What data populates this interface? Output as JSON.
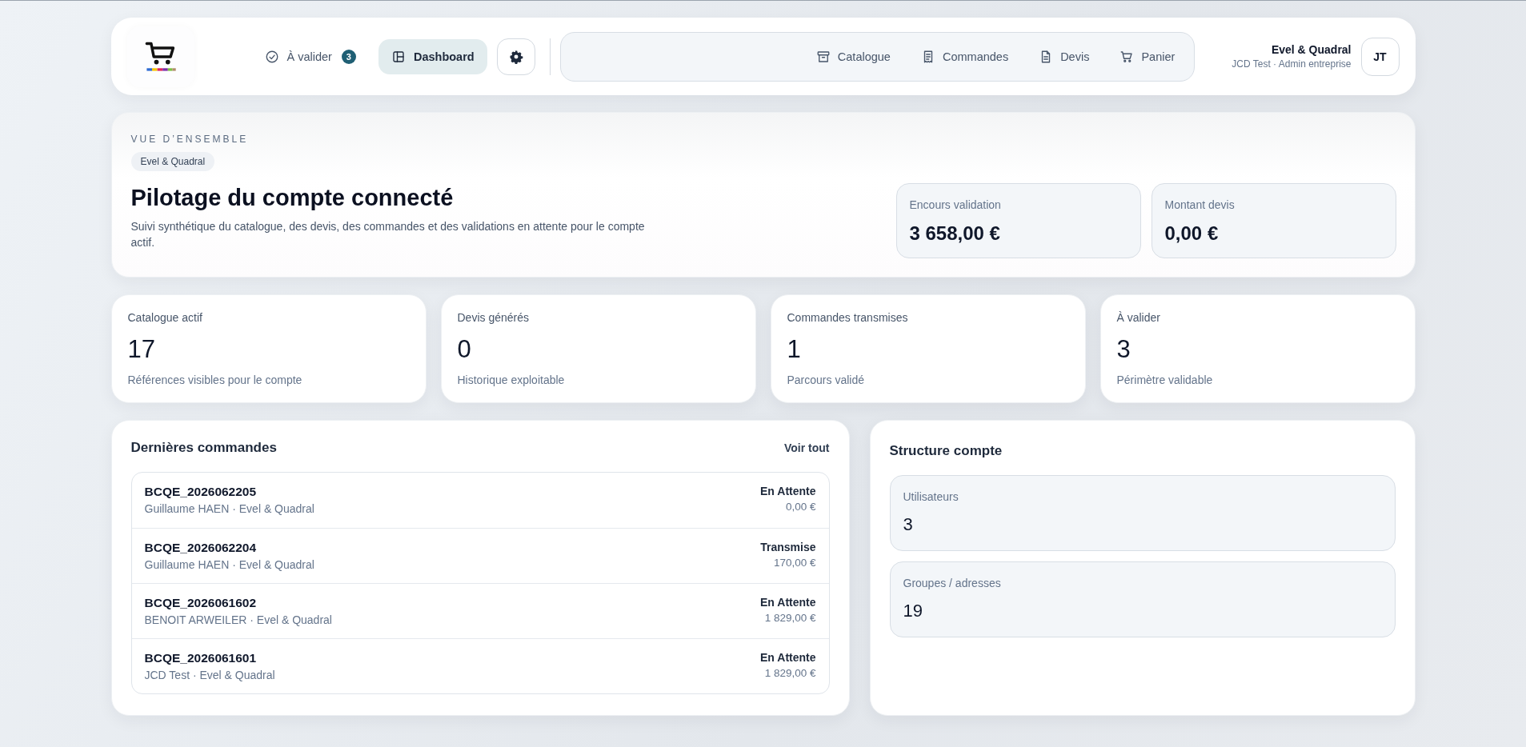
{
  "header": {
    "nav": [
      {
        "label": "À valider",
        "badge": "3",
        "selected": false
      },
      {
        "label": "Dashboard",
        "selected": true
      }
    ],
    "links": [
      {
        "label": "Catalogue",
        "selected": false
      },
      {
        "label": "Commandes",
        "selected": false
      },
      {
        "label": "Devis",
        "selected": false
      },
      {
        "label": "Panier",
        "selected": false
      }
    ],
    "user": {
      "name": "Evel & Quadral",
      "subtitle": "JCD Test · Admin entreprise",
      "initials": "JT"
    }
  },
  "overview": {
    "eyebrow": "VUE D’ENSEMBLE",
    "tag": "Evel & Quadral",
    "title": "Pilotage du compte connecté",
    "description": "Suivi synthétique du catalogue, des devis, des commandes et des validations en attente pour le compte actif.",
    "metrics": [
      {
        "label": "Encours validation",
        "value": "3 658,00 €"
      },
      {
        "label": "Montant devis",
        "value": "0,00 €"
      }
    ]
  },
  "stats": [
    {
      "label": "Catalogue actif",
      "value": "17",
      "caption": "Références visibles pour le compte"
    },
    {
      "label": "Devis générés",
      "value": "0",
      "caption": "Historique exploitable"
    },
    {
      "label": "Commandes transmises",
      "value": "1",
      "caption": "Parcours validé"
    },
    {
      "label": "À valider",
      "value": "3",
      "caption": "Périmètre validable"
    }
  ],
  "orders": {
    "title": "Dernières commandes",
    "link": "Voir tout",
    "rows": [
      {
        "ref": "BCQE_2026062205",
        "who": "Guillaume HAEN · Evel & Quadral",
        "status": "En Attente",
        "amount": "0,00 €"
      },
      {
        "ref": "BCQE_2026062204",
        "who": "Guillaume HAEN · Evel & Quadral",
        "status": "Transmise",
        "amount": "170,00 €"
      },
      {
        "ref": "BCQE_2026061602",
        "who": "BENOIT ARWEILER · Evel & Quadral",
        "status": "En Attente",
        "amount": "1 829,00 €"
      },
      {
        "ref": "BCQE_2026061601",
        "who": "JCD Test · Evel & Quadral",
        "status": "En Attente",
        "amount": "1 829,00 €"
      }
    ]
  },
  "structure": {
    "title": "Structure compte",
    "items": [
      {
        "label": "Utilisateurs",
        "value": "3"
      },
      {
        "label": "Groupes / adresses",
        "value": "19"
      }
    ]
  }
}
